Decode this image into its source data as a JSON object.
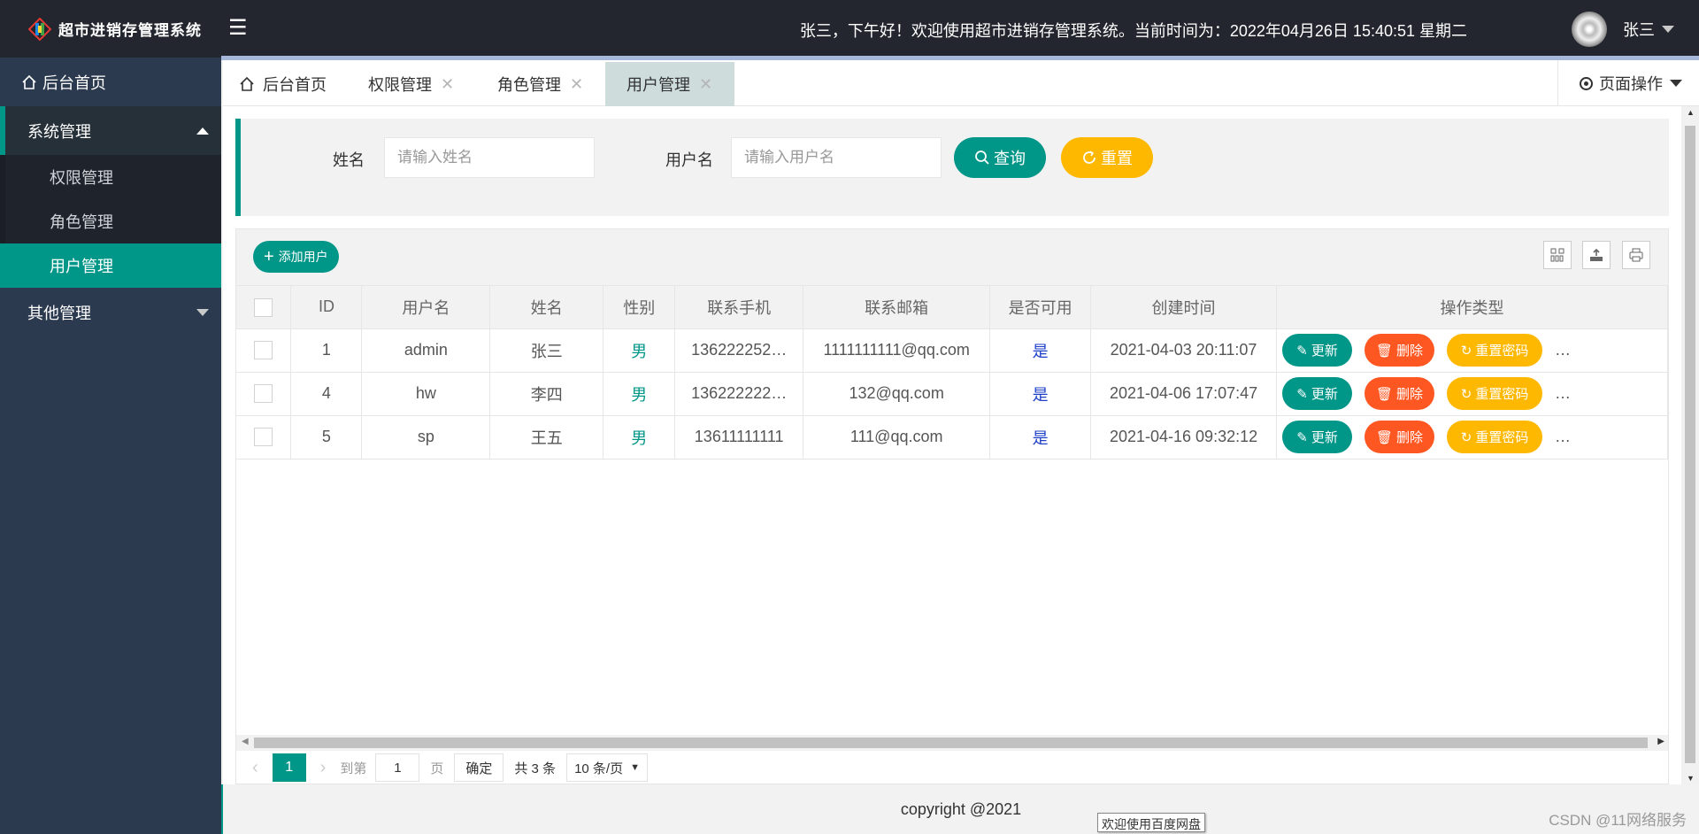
{
  "app": {
    "title": "超市进销存管理系统",
    "menu_toggle_icon": "hamburger-icon"
  },
  "header": {
    "greeting": "张三，下午好！欢迎使用超市进销存管理系统。当前时间为：2022年04月26日 15:40:51 星期二",
    "user_name": "张三"
  },
  "sidebar": {
    "home": "后台首页",
    "groups": [
      {
        "label": "系统管理",
        "items": [
          "权限管理",
          "角色管理",
          "用户管理"
        ],
        "active": "用户管理"
      },
      {
        "label": "其他管理"
      }
    ]
  },
  "tabs": [
    {
      "label": "后台首页"
    },
    {
      "label": "权限管理"
    },
    {
      "label": "角色管理"
    },
    {
      "label": "用户管理"
    }
  ],
  "page_ops": "页面操作",
  "search": {
    "name_label": "姓名",
    "name_placeholder": "请输入姓名",
    "username_label": "用户名",
    "username_placeholder": "请输入用户名",
    "query_btn": "查询",
    "reset_btn": "重置"
  },
  "toolbar": {
    "add_btn": "添加用户"
  },
  "table": {
    "columns": [
      "ID",
      "用户名",
      "姓名",
      "性别",
      "联系手机",
      "联系邮箱",
      "是否可用",
      "创建时间",
      "操作类型"
    ],
    "rows": [
      {
        "id": "1",
        "username": "admin",
        "name": "张三",
        "gender": "男",
        "phone": "136222252…",
        "email": "1111111111@qq.com",
        "enabled": "是",
        "created": "2021-04-03 20:11:07"
      },
      {
        "id": "4",
        "username": "hw",
        "name": "李四",
        "gender": "男",
        "phone": "136222222…",
        "email": "132@qq.com",
        "enabled": "是",
        "created": "2021-04-06 17:07:47"
      },
      {
        "id": "5",
        "username": "sp",
        "name": "王五",
        "gender": "男",
        "phone": "13611111111",
        "email": "111@qq.com",
        "enabled": "是",
        "created": "2021-04-16 09:32:12"
      }
    ],
    "actions": {
      "update": "更新",
      "delete": "删除",
      "reset_pwd": "重置密码",
      "more": "…"
    }
  },
  "pager": {
    "current": "1",
    "goto_label": "到第",
    "goto_value": "1",
    "page_unit": "页",
    "confirm": "确定",
    "total": "共 3 条",
    "page_size": "10 条/页"
  },
  "footer": "copyright @2021",
  "tooltip": "欢迎使用百度网盘",
  "watermark": "CSDN @11网络服务",
  "colors": {
    "primary": "#009688",
    "warning": "#ffb800",
    "danger": "#ff5722",
    "header_bg": "#23262e",
    "sidebar_bg": "#2b3a4f"
  }
}
